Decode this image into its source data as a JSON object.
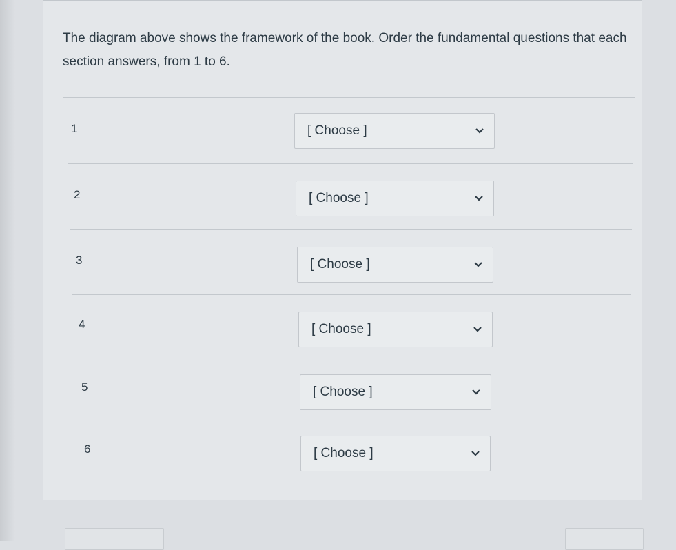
{
  "question": {
    "text": "The diagram above shows the framework of the book. Order the fundamental questions that each section answers, from 1 to 6."
  },
  "rows": [
    {
      "label": "1",
      "select_value": "[ Choose ]"
    },
    {
      "label": "2",
      "select_value": "[ Choose ]"
    },
    {
      "label": "3",
      "select_value": "[ Choose ]"
    },
    {
      "label": "4",
      "select_value": "[ Choose ]"
    },
    {
      "label": "5",
      "select_value": "[ Choose ]"
    },
    {
      "label": "6",
      "select_value": "[ Choose ]"
    }
  ],
  "icons": {
    "dropdown": "chevron-down-icon"
  },
  "colors": {
    "text": "#2d3b45",
    "card_background": "#e4e7ea",
    "border": "#c3c8cd"
  }
}
